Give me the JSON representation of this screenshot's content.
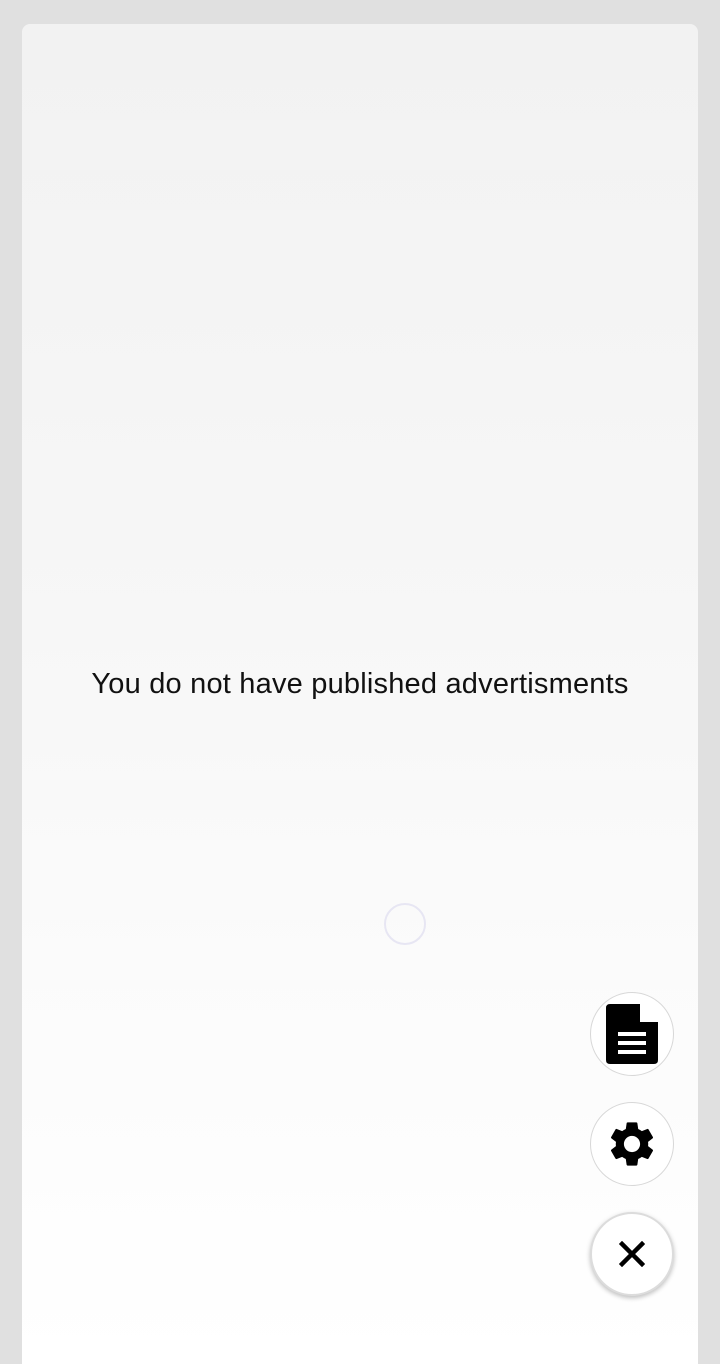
{
  "main": {
    "empty_message": "You do not have published advertisments"
  },
  "fab_menu": {
    "items": [
      {
        "name": "documents",
        "icon": "document-icon"
      },
      {
        "name": "settings",
        "icon": "gear-icon"
      },
      {
        "name": "close",
        "icon": "close-icon"
      }
    ]
  },
  "colors": {
    "background": "#e0e0e0",
    "card": "#f5f5f5",
    "text": "#111111",
    "icon": "#000000",
    "spinner": "#e7e6f3"
  }
}
